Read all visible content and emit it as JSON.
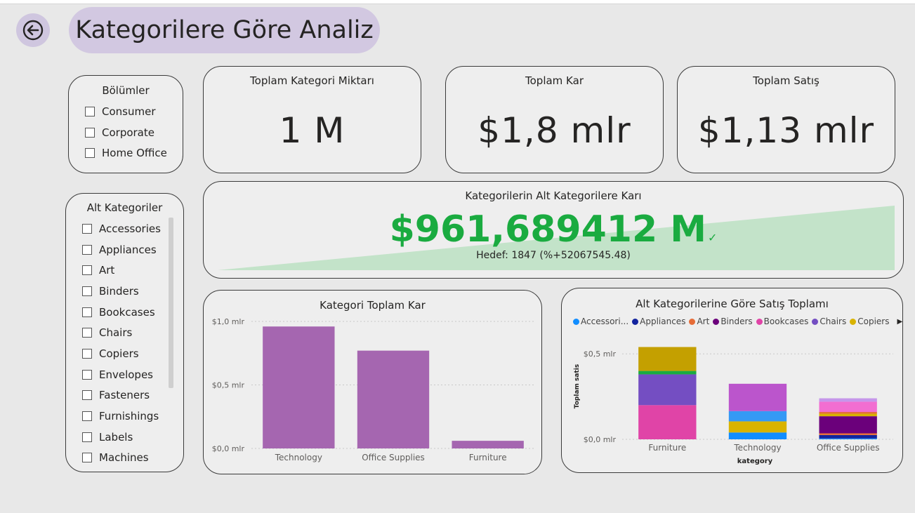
{
  "page": {
    "title": "Kategorilere Göre Analiz",
    "back_icon": "back-arrow-icon"
  },
  "segments_slicer": {
    "title": "Bölümler",
    "items": [
      "Consumer",
      "Corporate",
      "Home Office"
    ]
  },
  "subcategory_slicer": {
    "title": "Alt Kategoriler",
    "items": [
      "Accessories",
      "Appliances",
      "Art",
      "Binders",
      "Bookcases",
      "Chairs",
      "Copiers",
      "Envelopes",
      "Fasteners",
      "Furnishings",
      "Labels",
      "Machines"
    ]
  },
  "kpis": [
    {
      "title": "Toplam Kategori Miktarı",
      "value": "1 M"
    },
    {
      "title": "Toplam Kar",
      "value": "$1,8 mlr"
    },
    {
      "title": "Toplam Satış",
      "value": "$1,13 mlr"
    }
  ],
  "kpi_target": {
    "title": "Kategorilerin Alt Kategorilere Karı",
    "value": "$961,689412 M",
    "goal_text": "Hedef: 1847 (%+52067545.48)",
    "status_icon": "checkmark-icon",
    "value_color": "#1aab40",
    "trend_fill_color": "#c3e3c9"
  },
  "chart_data": [
    {
      "type": "bar",
      "title": "Kategori Toplam Kar",
      "categories": [
        "Technology",
        "Office Supplies",
        "Furniture"
      ],
      "values": [
        0.96,
        0.77,
        0.06
      ],
      "value_unit": "mlr",
      "ylim": [
        0,
        1.0
      ],
      "yticks": [
        0.0,
        0.5,
        1.0
      ],
      "ytick_labels": [
        "$0,0 mlr",
        "$0,5 mlr",
        "$1,0 mlr"
      ],
      "xlabel": "",
      "ylabel": "",
      "grid": true,
      "color": "#a566b0"
    },
    {
      "type": "bar",
      "stacked": true,
      "title": "Alt Kategorilerine Göre Satış Toplamı",
      "xlabel": "kategory",
      "ylabel": "Toplam satis",
      "categories": [
        "Furniture",
        "Technology",
        "Office Supplies"
      ],
      "ylim": [
        0,
        0.62
      ],
      "yticks": [
        0.0,
        0.5
      ],
      "ytick_labels": [
        "$0,0 mlr",
        "$0,5 mlr"
      ],
      "grid": true,
      "legend_position": "top",
      "legend": [
        {
          "label": "Accessori...",
          "color": "#118dff"
        },
        {
          "label": "Appliances",
          "color": "#12239e"
        },
        {
          "label": "Art",
          "color": "#e66c37"
        },
        {
          "label": "Binders",
          "color": "#6b007b"
        },
        {
          "label": "Bookcases",
          "color": "#e044a7"
        },
        {
          "label": "Chairs",
          "color": "#744ec2"
        },
        {
          "label": "Copiers",
          "color": "#d9b300"
        }
      ],
      "legend_more_icon": "triangle-right-icon",
      "series": [
        {
          "name": "Bookcases",
          "color": "#e044a7",
          "values": [
            0.2,
            0,
            0
          ]
        },
        {
          "name": "Chairs",
          "color": "#744ec2",
          "values": [
            0.18,
            0,
            0
          ]
        },
        {
          "color": "#1aab40",
          "values": [
            0.02,
            0,
            0
          ]
        },
        {
          "color": "#c4a000",
          "values": [
            0.14,
            0,
            0
          ]
        },
        {
          "name": "Accessories",
          "color": "#118dff",
          "values": [
            0,
            0.04,
            0.005
          ]
        },
        {
          "name": "Copiers",
          "color": "#d9b300",
          "values": [
            0,
            0.065,
            0
          ]
        },
        {
          "color": "#3599f5",
          "values": [
            0,
            0.06,
            0
          ]
        },
        {
          "color": "#bb55cc",
          "values": [
            0,
            0.16,
            0
          ]
        },
        {
          "name": "Appliances",
          "color": "#12239e",
          "values": [
            0,
            0,
            0.02
          ]
        },
        {
          "name": "Art",
          "color": "#e66c37",
          "values": [
            0,
            0,
            0.01
          ]
        },
        {
          "name": "Binders",
          "color": "#6b007b",
          "values": [
            0,
            0,
            0.1
          ]
        },
        {
          "color": "#d9b300",
          "values": [
            0,
            0,
            0.015
          ]
        },
        {
          "color": "#e66c37",
          "values": [
            0,
            0,
            0.01
          ]
        },
        {
          "color": "#f26ed1",
          "values": [
            0,
            0,
            0.06
          ]
        },
        {
          "color": "#c596ea",
          "values": [
            0,
            0,
            0.02
          ]
        }
      ]
    }
  ]
}
